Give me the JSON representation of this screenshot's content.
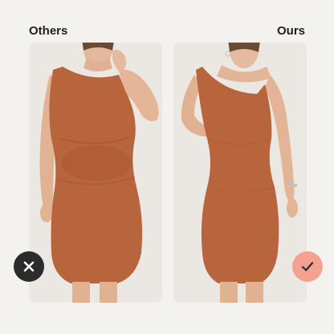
{
  "labels": {
    "others": "Others",
    "ours": "Ours"
  },
  "badges": {
    "others_icon": "x-icon",
    "ours_icon": "check-icon",
    "others_color": "#2b2b2b",
    "ours_color": "#f2a28f"
  },
  "colors": {
    "background": "#f4f2ef",
    "dress": "#b8643d",
    "skin": "#e8b99e"
  }
}
